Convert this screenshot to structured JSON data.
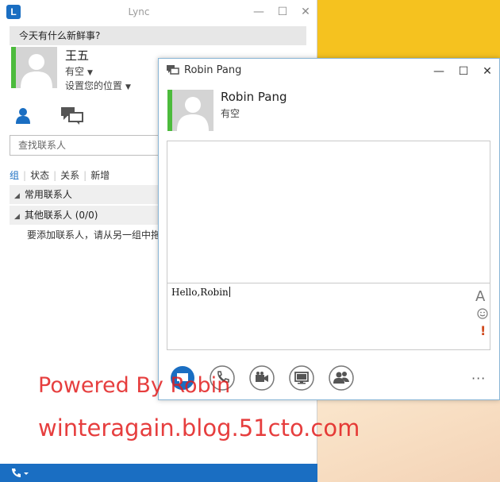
{
  "lync_window": {
    "title": "Lync",
    "note_placeholder": "今天有什么新鲜事?",
    "user": {
      "name": "王五",
      "status": "有空",
      "location": "设置您的位置"
    },
    "search_placeholder": "查找联系人",
    "filter_tabs": [
      "组",
      "状态",
      "关系",
      "新增"
    ],
    "groups": [
      {
        "label": "常用联系人"
      },
      {
        "label": "其他联系人 (0/0)"
      }
    ],
    "hint": "要添加联系人，请从另一组中拖"
  },
  "conversation": {
    "title": "Robin Pang",
    "contact": {
      "name": "Robin Pang",
      "status": "有空"
    },
    "compose_text": "Hello,Robin",
    "format_label": "A",
    "importance_label": "!",
    "more_label": "···"
  },
  "watermark": {
    "line1": "Powered By Robin",
    "line2": "winteragain.blog.51cto.com"
  },
  "colors": {
    "lync_blue": "#1a6ec2",
    "presence_available": "#4cbb3c",
    "desktop": "#f5c21f",
    "watermark": "#e21d1d"
  }
}
